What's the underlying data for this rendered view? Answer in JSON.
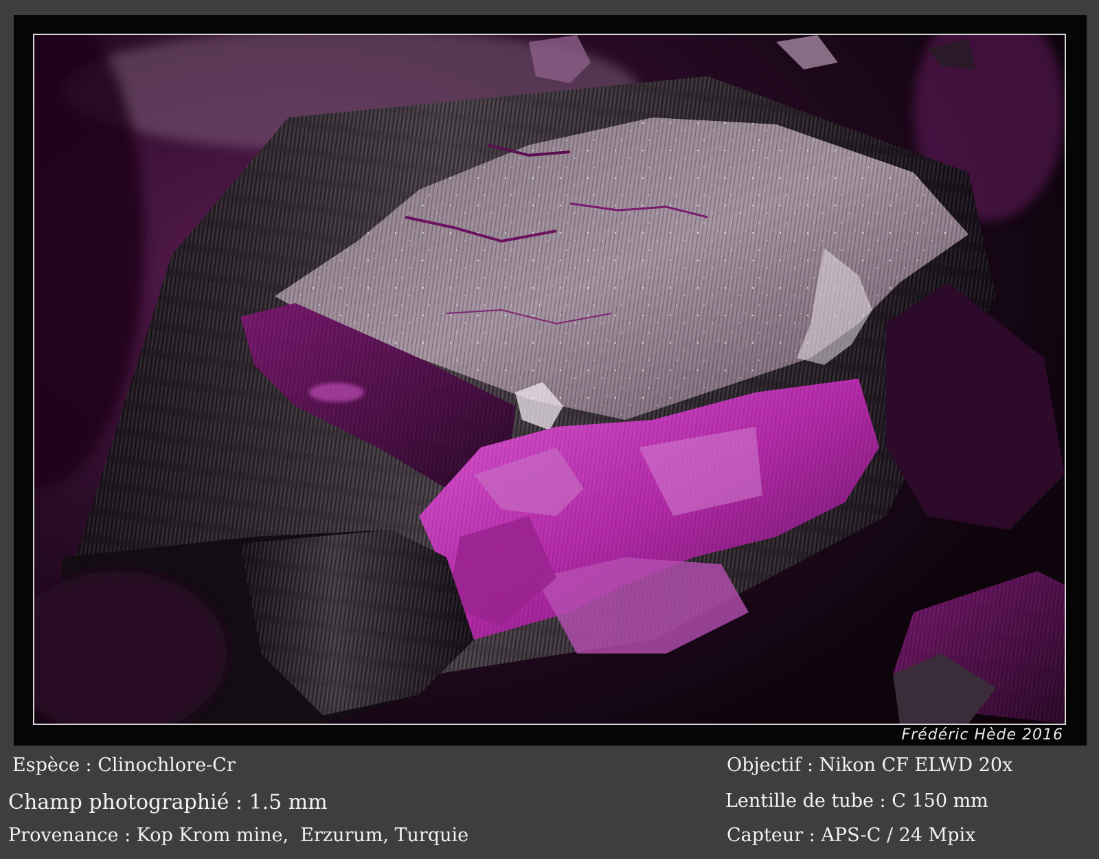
{
  "signature": "Frédéric Hède 2016",
  "captions": {
    "espece": "Espèce : Clinochlore-Cr",
    "champ": "Champ photographié : 1.5 mm",
    "provenance": "Provenance : Kop Krom mine,  Erzurum, Turquie",
    "objectif": "Objectif : Nikon CF ELWD 20x",
    "lentille": "Lentille de tube : C 150 mm",
    "capteur": "Capteur : APS-C / 24 Mpix"
  },
  "colors": {
    "background": "#3e3e3e",
    "mat": "#050505",
    "border": "#d9d9d9",
    "crystal_magenta": "#b32aa8",
    "crystal_grey": "#a89aa3"
  }
}
